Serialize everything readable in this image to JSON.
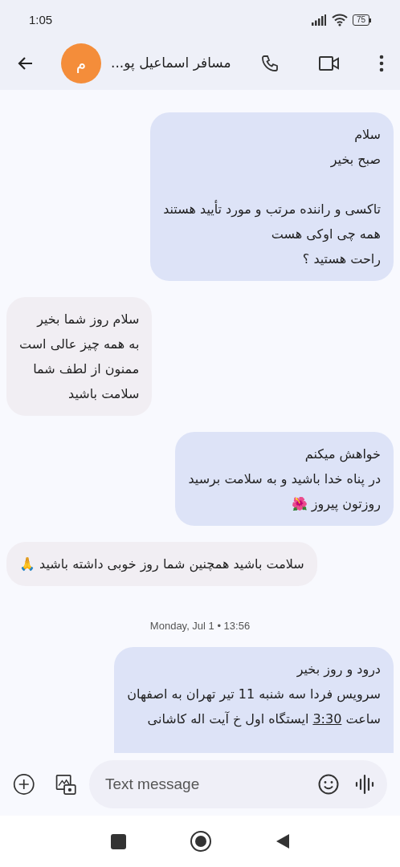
{
  "status_bar": {
    "time": "1:05",
    "battery": "75"
  },
  "header": {
    "avatar_letter": "م",
    "title": "مسافر اسماعیل پو..."
  },
  "messages": [
    {
      "kind": "sent",
      "paragraphs": [
        [
          "سلام",
          "صبح بخیر"
        ],
        [
          "تاکسی و راننده مرتب و مورد تأیید هستند",
          "همه چی اوکی هست",
          "راحت هستید ؟"
        ]
      ]
    },
    {
      "kind": "received",
      "paragraphs": [
        [
          "سلام روز شما بخیر",
          "به همه چیز عالی است",
          "ممنون از لطف شما",
          "سلامت باشید"
        ]
      ]
    },
    {
      "kind": "sent",
      "paragraphs": [
        [
          "خواهش میکنم",
          "در پناه خدا باشید و به سلامت برسید",
          "روزتون پیروز 🌺"
        ]
      ]
    },
    {
      "kind": "received",
      "paragraphs": [
        [
          "سلامت باشید همچنین شما روز خوبی داشته باشید 🙏"
        ]
      ]
    },
    {
      "kind": "timestamp",
      "text": "Monday, Jul 1 • 13:56"
    },
    {
      "kind": "sent",
      "cut": true,
      "paragraphs": [
        [
          "درود و روز بخیر",
          "سرویس فردا سه شنبه 11 تیر تهران به اصفهان",
          {
            "before": "ساعت",
            "link": "3:30",
            "after": "ایستگاه اول خ آیت اله کاشانی"
          }
        ]
      ]
    }
  ],
  "composer": {
    "placeholder": "Text message"
  }
}
